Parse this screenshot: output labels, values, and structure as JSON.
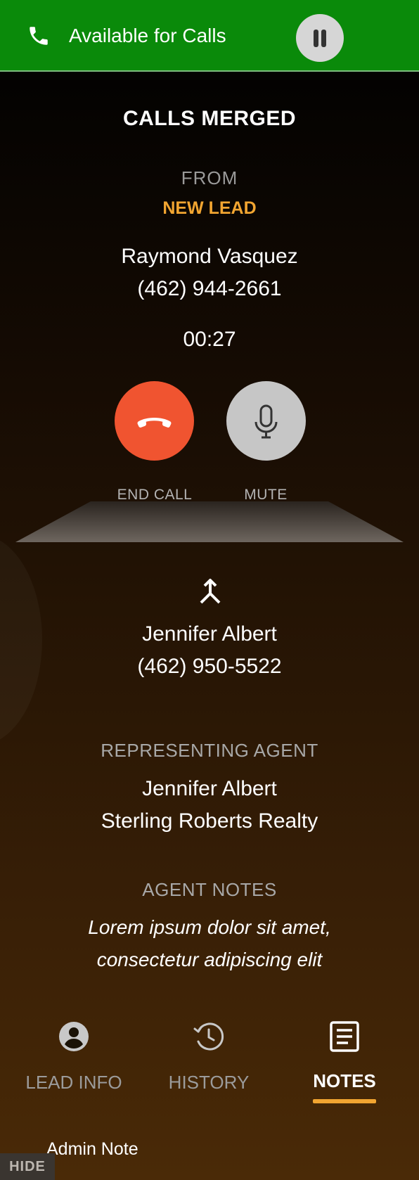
{
  "status_bar": {
    "label": "Available for Calls",
    "background": "#0a8a0a",
    "phone_icon": "phone-icon",
    "pause_icon": "pause-icon"
  },
  "call": {
    "title": "CALLS MERGED",
    "from_label": "FROM",
    "lead_status": "NEW LEAD",
    "caller_name": "Raymond Vasquez",
    "caller_phone": "(462) 944-2661",
    "timer": "00:27"
  },
  "controls": {
    "end_call_label": "END CALL",
    "mute_label": "MUTE",
    "end_call_color": "#f05430",
    "mute_color": "#c6c6c6"
  },
  "merged": {
    "icon": "merge-icon",
    "name": "Jennifer Albert",
    "phone": "(462) 950-5522"
  },
  "representing_agent": {
    "label": "REPRESENTING AGENT",
    "name": "Jennifer Albert",
    "company": "Sterling Roberts Realty"
  },
  "agent_notes": {
    "label": "AGENT NOTES",
    "line1": "Lorem ipsum dolor sit amet,",
    "line2": "consectetur adipiscing elit"
  },
  "tabs": [
    {
      "label": "LEAD INFO",
      "icon": "account-circle-icon",
      "active": false
    },
    {
      "label": "HISTORY",
      "icon": "history-clock-icon",
      "active": false
    },
    {
      "label": "NOTES",
      "icon": "notes-icon",
      "active": true
    }
  ],
  "accent_color": "#f2a531",
  "admin_note_label": "Admin Note",
  "hide_label": "HIDE"
}
